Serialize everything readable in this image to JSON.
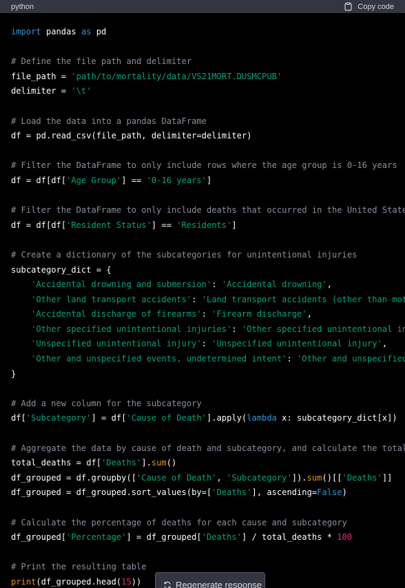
{
  "header": {
    "language": "python",
    "copy_label": "Copy code"
  },
  "regenerate_label": "Regenerate response",
  "code": [
    [
      [
        "k",
        "import"
      ],
      [
        "t",
        " pandas "
      ],
      [
        "k",
        "as"
      ],
      [
        "t",
        " pd"
      ]
    ],
    [],
    [
      [
        "c",
        "# Define the file path and delimiter"
      ]
    ],
    [
      [
        "t",
        "file_path = "
      ],
      [
        "s",
        "'path/to/mortality/data/VS21MORT.DUSMCPUB'"
      ]
    ],
    [
      [
        "t",
        "delimiter = "
      ],
      [
        "s",
        "'\\t'"
      ]
    ],
    [],
    [
      [
        "c",
        "# Load the data into a pandas DataFrame"
      ]
    ],
    [
      [
        "t",
        "df = pd.read_csv(file_path, delimiter=delimiter)"
      ]
    ],
    [],
    [
      [
        "c",
        "# Filter the DataFrame to only include rows where the age group is 0-16 years"
      ]
    ],
    [
      [
        "t",
        "df = df[df["
      ],
      [
        "s",
        "'Age Group'"
      ],
      [
        "t",
        "] == "
      ],
      [
        "s",
        "'0-16 years'"
      ],
      [
        "t",
        "]"
      ]
    ],
    [],
    [
      [
        "c",
        "# Filter the DataFrame to only include deaths that occurred in the United States"
      ]
    ],
    [
      [
        "t",
        "df = df[df["
      ],
      [
        "s",
        "'Resident Status'"
      ],
      [
        "t",
        "] == "
      ],
      [
        "s",
        "'Residents'"
      ],
      [
        "t",
        "]"
      ]
    ],
    [],
    [
      [
        "c",
        "# Create a dictionary of the subcategories for unintentional injuries"
      ]
    ],
    [
      [
        "t",
        "subcategory_dict = {"
      ]
    ],
    [
      [
        "t",
        "    "
      ],
      [
        "s",
        "'Accidental drowning and submersion'"
      ],
      [
        "t",
        ": "
      ],
      [
        "s",
        "'Accidental drowning'"
      ],
      [
        "t",
        ","
      ]
    ],
    [
      [
        "t",
        "    "
      ],
      [
        "s",
        "'Other land transport accidents'"
      ],
      [
        "t",
        ": "
      ],
      [
        "s",
        "'Land transport accidents (other than motor vehicle)'"
      ],
      [
        "t",
        ","
      ]
    ],
    [
      [
        "t",
        "    "
      ],
      [
        "s",
        "'Accidental discharge of firearms'"
      ],
      [
        "t",
        ": "
      ],
      [
        "s",
        "'Firearm discharge'"
      ],
      [
        "t",
        ","
      ]
    ],
    [
      [
        "t",
        "    "
      ],
      [
        "s",
        "'Other specified unintentional injuries'"
      ],
      [
        "t",
        ": "
      ],
      [
        "s",
        "'Other specified unintentional injuries'"
      ],
      [
        "t",
        ","
      ]
    ],
    [
      [
        "t",
        "    "
      ],
      [
        "s",
        "'Unspecified unintentional injury'"
      ],
      [
        "t",
        ": "
      ],
      [
        "s",
        "'Unspecified unintentional injury'"
      ],
      [
        "t",
        ","
      ]
    ],
    [
      [
        "t",
        "    "
      ],
      [
        "s",
        "'Other and unspecified events, undetermined intent'"
      ],
      [
        "t",
        ": "
      ],
      [
        "s",
        "'Other and unspecified events'"
      ]
    ],
    [
      [
        "t",
        "}"
      ]
    ],
    [],
    [
      [
        "c",
        "# Add a new column for the subcategory"
      ]
    ],
    [
      [
        "t",
        "df["
      ],
      [
        "s",
        "'Subcategory'"
      ],
      [
        "t",
        "] = df["
      ],
      [
        "s",
        "'Cause of Death'"
      ],
      [
        "t",
        "].apply("
      ],
      [
        "k",
        "lambda"
      ],
      [
        "t",
        " x: subcategory_dict[x])"
      ]
    ],
    [],
    [
      [
        "c",
        "# Aggregate the data by cause of death and subcategory, and calculate the totals"
      ]
    ],
    [
      [
        "t",
        "total_deaths = df["
      ],
      [
        "s",
        "'Deaths'"
      ],
      [
        "t",
        "]."
      ],
      [
        "b",
        "sum"
      ],
      [
        "t",
        "()"
      ]
    ],
    [
      [
        "t",
        "df_grouped = df.groupby(["
      ],
      [
        "s",
        "'Cause of Death'"
      ],
      [
        "t",
        ", "
      ],
      [
        "s",
        "'Subcategory'"
      ],
      [
        "t",
        "])."
      ],
      [
        "b",
        "sum"
      ],
      [
        "t",
        "()[["
      ],
      [
        "s",
        "'Deaths'"
      ],
      [
        "t",
        "]]"
      ]
    ],
    [
      [
        "t",
        "df_grouped = df_grouped.sort_values(by=["
      ],
      [
        "s",
        "'Deaths'"
      ],
      [
        "t",
        "], ascending="
      ],
      [
        "k",
        "False"
      ],
      [
        "t",
        ")"
      ]
    ],
    [],
    [
      [
        "c",
        "# Calculate the percentage of deaths for each cause and subcategory"
      ]
    ],
    [
      [
        "t",
        "df_grouped["
      ],
      [
        "s",
        "'Percentage'"
      ],
      [
        "t",
        "] = df_grouped["
      ],
      [
        "s",
        "'Deaths'"
      ],
      [
        "t",
        "] / total_deaths * "
      ],
      [
        "n",
        "100"
      ]
    ],
    [],
    [
      [
        "c",
        "# Print the resulting table"
      ]
    ],
    [
      [
        "b",
        "print"
      ],
      [
        "t",
        "(df_grouped.head("
      ],
      [
        "n",
        "15"
      ],
      [
        "t",
        "))"
      ]
    ]
  ]
}
